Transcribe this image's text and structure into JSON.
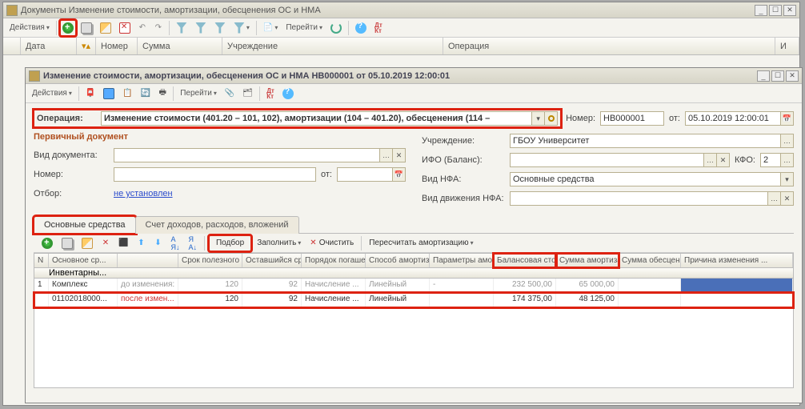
{
  "outer": {
    "title": "Документы  Изменение стоимости, амортизации, обесценения ОС и НМА",
    "actions": "Действия",
    "goto": "Перейти",
    "grid_headers": [
      "",
      "Дата",
      "",
      "Номер",
      "Сумма",
      "Учреждение",
      "Операция",
      "И"
    ]
  },
  "inner": {
    "title": "Изменение стоимости, амортизации, обесценения ОС и НМА НВ000001 от 05.10.2019 12:00:01",
    "actions": "Действия",
    "goto": "Перейти",
    "op_label": "Операция:",
    "op_value": "Изменение стоимости (401.20 – 101, 102), амортизации (104 – 401.20), обесценения (114 –",
    "num_label": "Номер:",
    "num_value": "НВ000001",
    "from_label": "от:",
    "date_value": "05.10.2019 12:00:01",
    "section": "Первичный документ",
    "doc_type_label": "Вид документа:",
    "number_label": "Номер:",
    "ot_label": "от:",
    "filter_label": "Отбор:",
    "filter_link": "не установлен",
    "org_label": "Учреждение:",
    "org_value": "ГБОУ Университет",
    "ifo_label": "ИФО (Баланс):",
    "kfo_label": "КФО:",
    "kfo_value": "2",
    "nfa_label": "Вид НФА:",
    "nfa_value": "Основные средства",
    "move_label": "Вид движения НФА:",
    "tabs": [
      "Основные средства",
      "Счет доходов, расходов, вложений"
    ],
    "sub_select": "Подбор",
    "sub_fill": "Заполнить",
    "sub_clear": "Очистить",
    "sub_recalc": "Пересчитать амортизацию",
    "cols": {
      "n": "N",
      "c1a": "Основное ср...",
      "c1b": "Инвентарны...",
      "c2": "",
      "c3": "Срок полезного ...",
      "c4": "Оставшийся срок",
      "c5": "Порядок погашения ...",
      "c6": "Способ амортизации",
      "c7": "Параметры амортизации",
      "c8": "Балансовая стоимость",
      "c9": "Сумма амортизации",
      "c10": "Сумма обесценения",
      "c11": "Причина изменения ..."
    },
    "rows": [
      {
        "n": "1",
        "name": "Комплекс",
        "inv": "01102018000...",
        "status_before": "до изменения:",
        "status_after": "после измен...",
        "srok_b": "120",
        "ost_b": "92",
        "por_b": "Начисление ...",
        "sposob_b": "Линейный",
        "param_b": "-",
        "bal_b": "232 500,00",
        "amort_b": "65 000,00",
        "srok_a": "120",
        "ost_a": "92",
        "por_a": "Начисление ...",
        "sposob_a": "Линейный",
        "bal_a": "174 375,00",
        "amort_a": "48 125,00"
      }
    ]
  }
}
